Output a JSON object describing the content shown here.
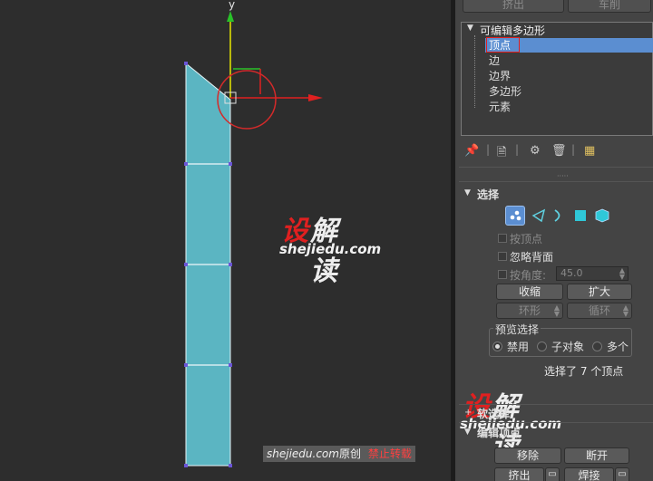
{
  "viewport": {
    "axis_y_label": "y",
    "watermark": {
      "part1": "设",
      "part2": "解读",
      "site": "shejiedu.com"
    },
    "footer": {
      "site": "shejiedu.com",
      "original": "原创",
      "warning": "禁止转载"
    }
  },
  "panel": {
    "top_buttons": [
      "挤出",
      "车削"
    ],
    "modifier_stack": {
      "root": "可编辑多边形",
      "items": [
        "顶点",
        "边",
        "边界",
        "多边形",
        "元素"
      ],
      "selected": "顶点"
    },
    "selection": {
      "title": "选择",
      "by_vertex": "按顶点",
      "ignore_backfacing": "忽略背面",
      "by_angle": "按角度:",
      "angle_value": "45.0",
      "shrink": "收缩",
      "grow": "扩大",
      "ring": "环形",
      "loop": "循环",
      "preview_group": "预览选择",
      "preview_options": [
        "禁用",
        "子对象",
        "多个"
      ],
      "status": "选择了 7 个顶点"
    },
    "soft_selection": {
      "title": "软选择"
    },
    "edit_vertices": {
      "title": "编辑顶点",
      "remove": "移除",
      "break": "断开",
      "extrude": "挤出",
      "weld": "焊接"
    },
    "colors": {
      "accent_blue": "#5b8ed1",
      "highlight_red": "#e02020",
      "mesh_fill": "#5bb5c2"
    }
  }
}
